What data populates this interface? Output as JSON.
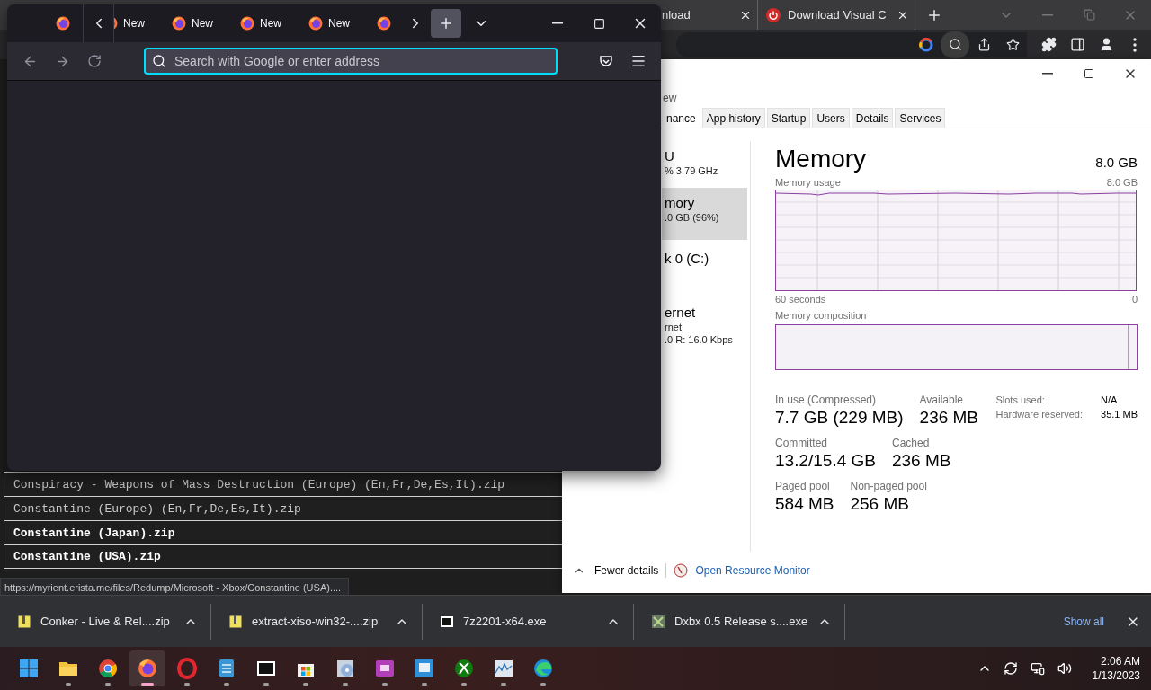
{
  "chrome_window": {
    "tabs": [
      {
        "title": "nload"
      },
      {
        "title": "Download Visual C"
      }
    ],
    "listing": [
      {
        "name": "Conspiracy - Weapons of Mass Destruction (Europe) (En,Fr,De,Es,It).zip",
        "visited": true
      },
      {
        "name": "Constantine (Europe) (En,Fr,De,Es,It).zip",
        "visited": true
      },
      {
        "name": "Constantine (Japan).zip",
        "visited": false
      },
      {
        "name": "Constantine (USA).zip",
        "visited": false
      }
    ],
    "status_url": "https://myrient.erista.me/files/Redump/Microsoft - Xbox/Constantine (USA)...."
  },
  "task_manager": {
    "menu": "ew",
    "tabs": [
      {
        "label": "nance",
        "selected": true
      },
      {
        "label": "App history",
        "selected": false
      },
      {
        "label": "Startup",
        "selected": false
      },
      {
        "label": "Users",
        "selected": false
      },
      {
        "label": "Details",
        "selected": false
      },
      {
        "label": "Services",
        "selected": false
      }
    ],
    "sidebar": [
      {
        "name": "U",
        "detail": "% 3.79 GHz",
        "selected": false
      },
      {
        "name": "mory",
        "detail": ".0 GB (96%)",
        "selected": true
      },
      {
        "name": "k 0 (C:)",
        "selected": false
      },
      {
        "name": "ernet",
        "subtitle": "rnet",
        "detail": ".0 R: 16.0 Kbps",
        "selected": false
      }
    ],
    "heading": "Memory",
    "capacity": "8.0 GB",
    "usage_label": "Memory usage",
    "usage_max": "8.0 GB",
    "axis_start": "60 seconds",
    "axis_end": "0",
    "composition_label": "Memory composition",
    "stats": [
      [
        {
          "label": "In use (Compressed)",
          "value": "7.7 GB (229 MB)"
        },
        {
          "label": "Available",
          "value": "236 MB"
        }
      ],
      [
        {
          "label": "Committed",
          "value": "13.2/15.4 GB"
        },
        {
          "label": "Cached",
          "value": "236 MB"
        }
      ],
      [
        {
          "label": "Paged pool",
          "value": "584 MB"
        },
        {
          "label": "Non-paged pool",
          "value": "256 MB"
        }
      ]
    ],
    "details": [
      {
        "label": "Slots used:",
        "value": "N/A"
      },
      {
        "label": "Hardware reserved:",
        "value": "35.1 MB"
      }
    ],
    "fewer_details": "Fewer details",
    "resource_monitor": "Open Resource Monitor"
  },
  "firefox_window": {
    "tabs": [
      {
        "pinned": true
      },
      {
        "title": "New",
        "pinned": false
      },
      {
        "title": "New",
        "pinned": false
      },
      {
        "title": "New",
        "pinned": false
      },
      {
        "title": "New",
        "pinned": false
      },
      {
        "pinned": false
      }
    ],
    "new_tab_hovered": true,
    "address_bar": {
      "placeholder": "Search with Google or enter address",
      "focused": true
    }
  },
  "download_bar": {
    "items": [
      {
        "name": "Conker - Live & Rel....zip",
        "kind": "zip"
      },
      {
        "name": "extract-xiso-win32-....zip",
        "kind": "zip"
      },
      {
        "name": "7z2201-x64.exe",
        "kind": "sevenzip"
      },
      {
        "name": "Dxbx 0.5 Release s....exe",
        "kind": "dxbx"
      }
    ],
    "show_all": "Show all"
  },
  "taskbar": {
    "apps": [
      {
        "kind": "start",
        "running": false,
        "selected": false
      },
      {
        "kind": "folder",
        "running": true,
        "selected": false
      },
      {
        "kind": "chrome",
        "running": true,
        "selected": false
      },
      {
        "kind": "firefox",
        "running": true,
        "selected": true
      },
      {
        "kind": "opera",
        "running": true,
        "selected": false
      },
      {
        "kind": "notepad",
        "running": true,
        "selected": false
      },
      {
        "kind": "sevenzip",
        "running": true,
        "selected": false
      },
      {
        "kind": "store",
        "running": true,
        "selected": false
      },
      {
        "kind": "media",
        "running": true,
        "selected": false
      },
      {
        "kind": "viewer",
        "running": true,
        "selected": false
      },
      {
        "kind": "tool",
        "running": true,
        "selected": false
      },
      {
        "kind": "xbox",
        "running": true,
        "selected": false
      },
      {
        "kind": "monitor",
        "running": true,
        "selected": false
      },
      {
        "kind": "edge",
        "running": true,
        "selected": false
      }
    ],
    "time": "2:06 AM",
    "date": "1/13/2023"
  }
}
